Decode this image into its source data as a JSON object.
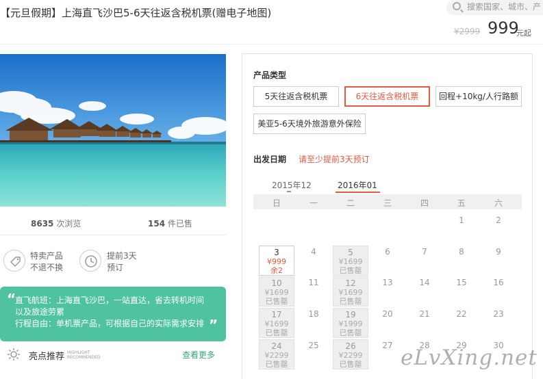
{
  "header": {
    "title": "【元旦假期】上海直飞沙巴5-6天往返含税机票(赠电子地图)",
    "search_placeholder": "搜索国家、城市、产",
    "orig_price": "¥2999",
    "price": "999",
    "price_unit": "元起"
  },
  "stats": {
    "views": "8635",
    "views_label": "次浏览",
    "sold": "154",
    "sold_label": "件已售"
  },
  "features": [
    {
      "line1": "特卖产品",
      "line2": "不退不换",
      "icon": "tag-icon"
    },
    {
      "line1": "提前3天",
      "line2": "预订",
      "icon": "clock-icon"
    }
  ],
  "highlight": {
    "line1": "直飞航班：上海直飞沙巴，一站直达，省去转机时间",
    "line2": "以及旅途劳累",
    "line3": "行程自由：单机票产品，可根据自己的实际需求安排"
  },
  "recommend": {
    "label": "亮点推荐",
    "en_line1": "HIGHLIGHT",
    "en_line2": "RECOMMENDED",
    "more": "查看更多"
  },
  "panel": {
    "product_type_title": "产品类型",
    "options": [
      "5天往返含税机票",
      "6天往返含税机票",
      "回程+10kg/人行路额",
      "美亚5-6天境外旅游意外保险"
    ],
    "selected_option": 1,
    "date_title": "出发日期",
    "date_tip": "请至少提前3天预订",
    "months": [
      "2015年12",
      "2016年01"
    ],
    "active_month": 1,
    "weekdays": [
      "日",
      "一",
      "二",
      "三",
      "四",
      "五",
      "六"
    ],
    "calendar": [
      [
        null,
        null,
        null,
        null,
        null,
        {
          "d": "1"
        },
        {
          "d": "2"
        }
      ],
      [
        {
          "d": "3",
          "p": "¥999",
          "s": "余2",
          "state": "avail"
        },
        {
          "d": "4"
        },
        {
          "d": "5",
          "p": "¥1699",
          "s": "已售罄",
          "state": "grey"
        },
        {
          "d": "6"
        },
        {
          "d": "7"
        },
        {
          "d": "8"
        },
        {
          "d": "9"
        }
      ],
      [
        {
          "d": "10",
          "p": "¥1699",
          "s": "已售罄",
          "state": "grey"
        },
        {
          "d": "11"
        },
        {
          "d": "12",
          "p": "¥1699",
          "s": "已售罄",
          "state": "grey"
        },
        {
          "d": "13"
        },
        {
          "d": "14"
        },
        {
          "d": "15"
        },
        {
          "d": "16"
        }
      ],
      [
        {
          "d": "17",
          "p": "¥1699",
          "s": "已售罄",
          "state": "grey"
        },
        {
          "d": "18"
        },
        {
          "d": "19",
          "p": "¥1999",
          "s": "已售罄",
          "state": "grey"
        },
        {
          "d": "20"
        },
        {
          "d": "21"
        },
        {
          "d": "22"
        },
        {
          "d": "23"
        }
      ],
      [
        {
          "d": "24",
          "p": "¥2299",
          "s": "已售罄",
          "state": "grey"
        },
        {
          "d": "25"
        },
        {
          "d": "26",
          "p": "¥2299",
          "s": "已售罄",
          "state": "grey"
        },
        {
          "d": "27"
        },
        {
          "d": "28"
        },
        {
          "d": "29"
        },
        {
          "d": "30"
        }
      ]
    ]
  },
  "watermark": "eLvXing.net",
  "colors": {
    "accent": "#e4593f",
    "green": "#4fc3a0"
  }
}
